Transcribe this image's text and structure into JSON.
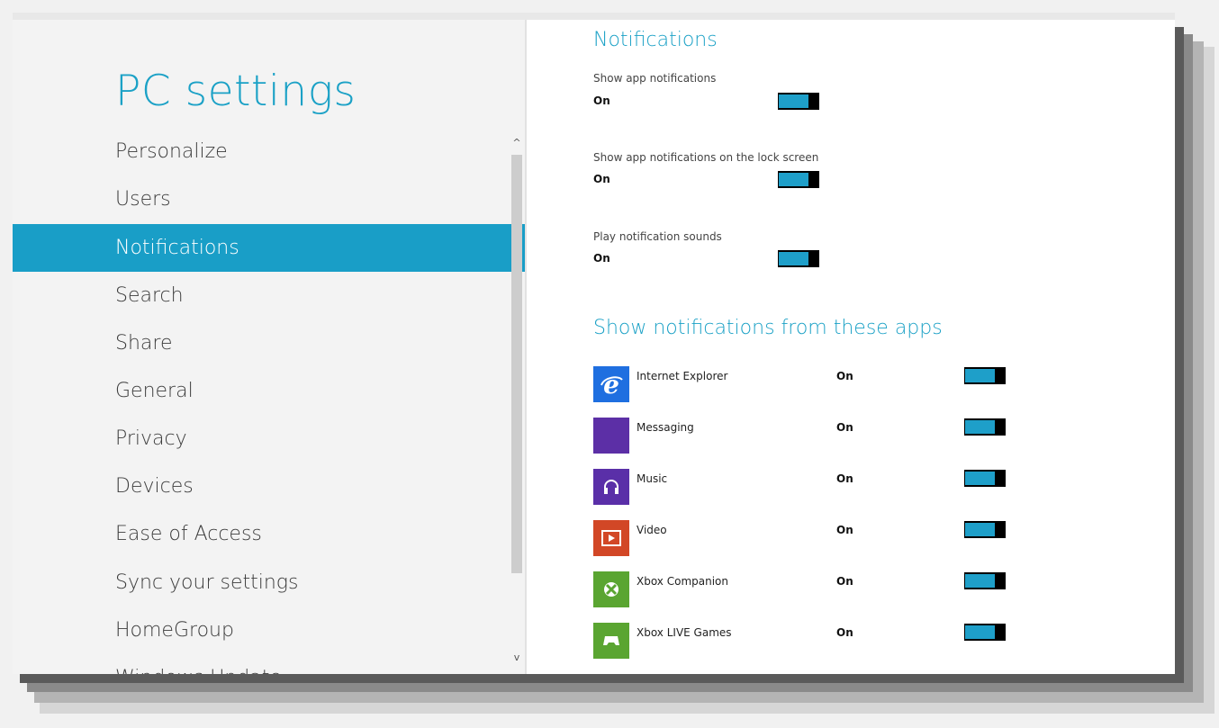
{
  "app": {
    "title": "PC settings"
  },
  "nav": {
    "items": [
      {
        "label": "Personalize"
      },
      {
        "label": "Users"
      },
      {
        "label": "Notifications",
        "selected": true
      },
      {
        "label": "Search"
      },
      {
        "label": "Share"
      },
      {
        "label": "General"
      },
      {
        "label": "Privacy"
      },
      {
        "label": "Devices"
      },
      {
        "label": "Ease of Access"
      },
      {
        "label": "Sync your settings"
      },
      {
        "label": "HomeGroup"
      },
      {
        "label": "Windows Update"
      }
    ],
    "scroll_up_glyph": "^",
    "scroll_down_glyph": "v"
  },
  "notifications": {
    "heading": "Notifications",
    "settings": [
      {
        "label": "Show app notifications",
        "state": "On"
      },
      {
        "label": "Show app notifications on the lock screen",
        "state": "On"
      },
      {
        "label": "Play notification sounds",
        "state": "On"
      }
    ]
  },
  "apps_section": {
    "heading": "Show notifications from these apps",
    "apps": [
      {
        "name": "Internet Explorer",
        "state": "On",
        "icon": "internet-explorer-icon",
        "color": "#1f6fe0"
      },
      {
        "name": "Messaging",
        "state": "On",
        "icon": "messaging-icon",
        "color": "#5c2fa6"
      },
      {
        "name": "Music",
        "state": "On",
        "icon": "headphones-icon",
        "color": "#5a2fa8"
      },
      {
        "name": "Video",
        "state": "On",
        "icon": "play-icon",
        "color": "#d24726"
      },
      {
        "name": "Xbox Companion",
        "state": "On",
        "icon": "xbox-icon",
        "color": "#5aa531"
      },
      {
        "name": "Xbox LIVE Games",
        "state": "On",
        "icon": "gamepad-icon",
        "color": "#5aa531"
      }
    ]
  },
  "colors": {
    "accent": "#199ec7",
    "toggle_fill": "#1e9fc9"
  }
}
